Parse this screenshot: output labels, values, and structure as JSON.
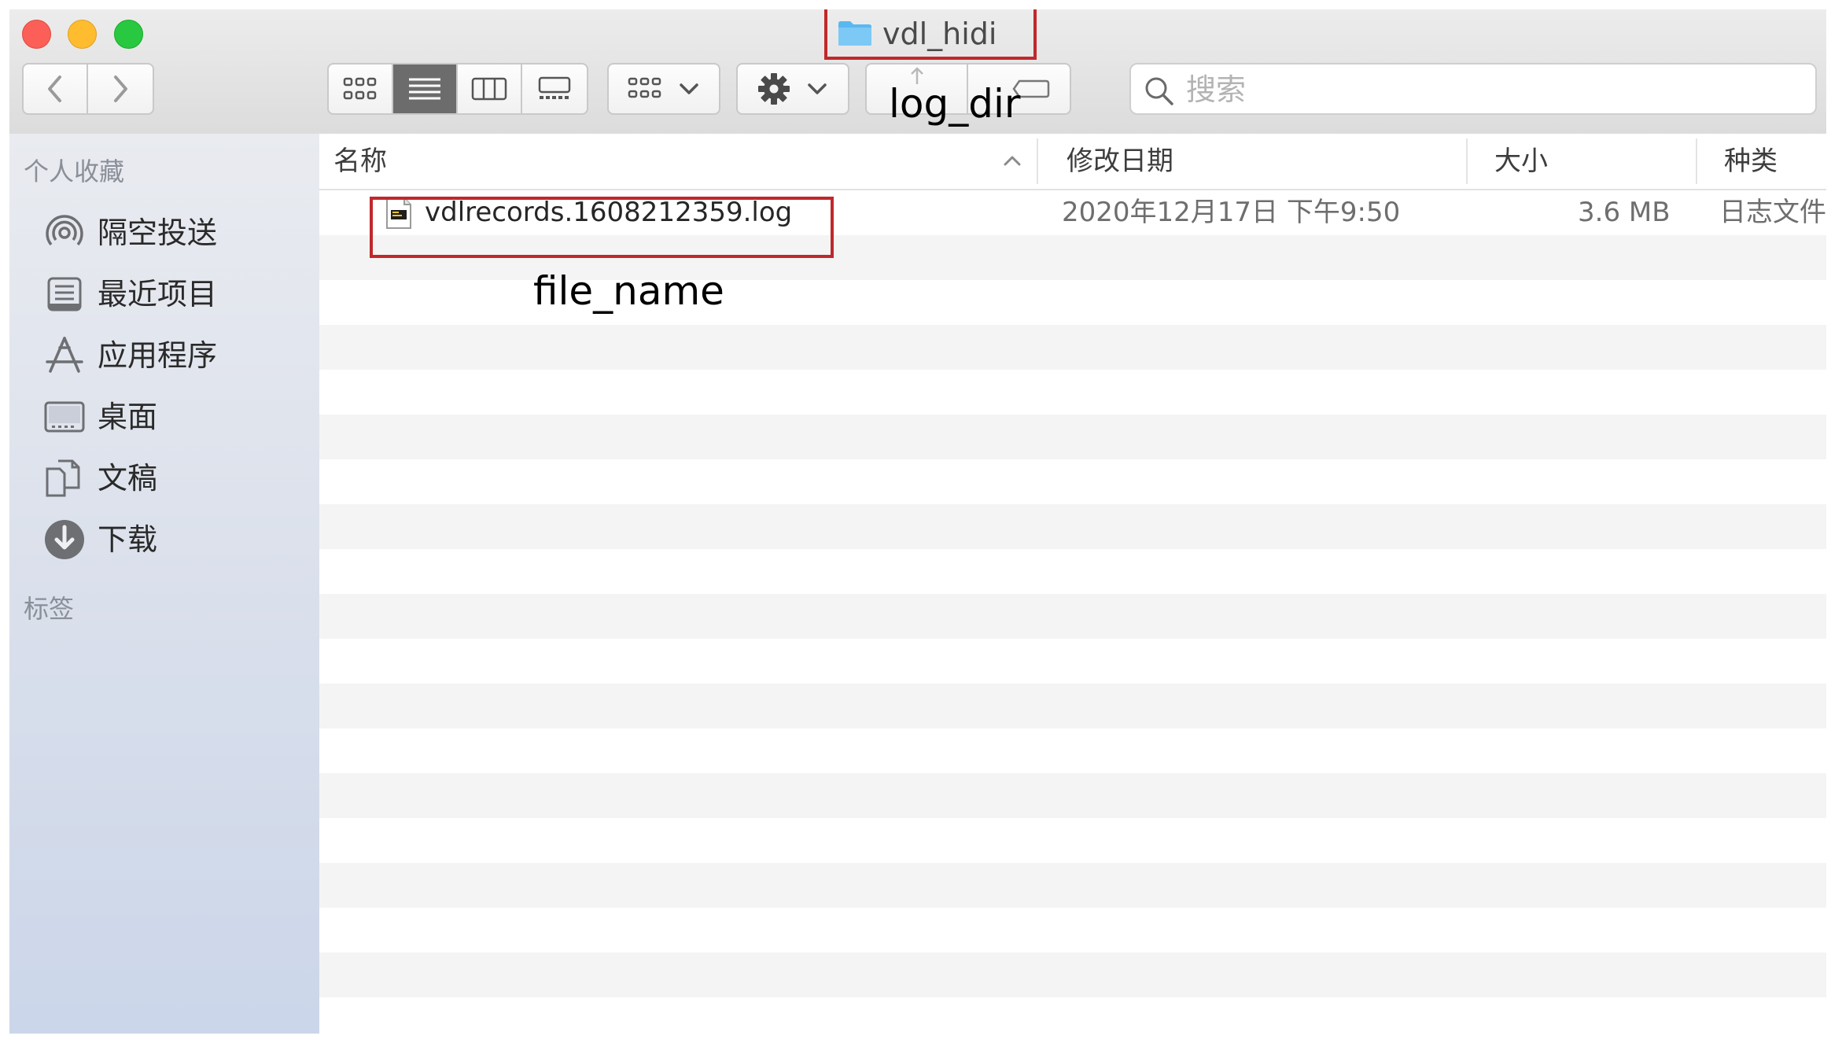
{
  "window": {
    "title": "vdl_hidi"
  },
  "toolbar": {
    "search_placeholder": "搜索"
  },
  "annotations": {
    "log_dir": "log_dir",
    "file_name": "file_name"
  },
  "sidebar": {
    "favorites_header": "个人收藏",
    "items": [
      {
        "label": "隔空投送",
        "icon": "airdrop-icon"
      },
      {
        "label": "最近项目",
        "icon": "recents-icon"
      },
      {
        "label": "应用程序",
        "icon": "applications-icon"
      },
      {
        "label": "桌面",
        "icon": "desktop-icon"
      },
      {
        "label": "文稿",
        "icon": "documents-icon"
      },
      {
        "label": "下载",
        "icon": "downloads-icon"
      }
    ],
    "tags_header": "标签"
  },
  "list": {
    "columns": {
      "name": "名称",
      "date": "修改日期",
      "size": "大小",
      "kind": "种类"
    },
    "rows": [
      {
        "name": "vdlrecords.1608212359.log",
        "date": "2020年12月17日 下午9:50",
        "size": "3.6 MB",
        "kind": "日志文件"
      }
    ]
  },
  "colors": {
    "annotation_red": "#c0282b",
    "close": "#fc5f57",
    "minimize": "#febc2e",
    "zoom": "#28c840",
    "folder_blue": "#5ab8f0"
  }
}
